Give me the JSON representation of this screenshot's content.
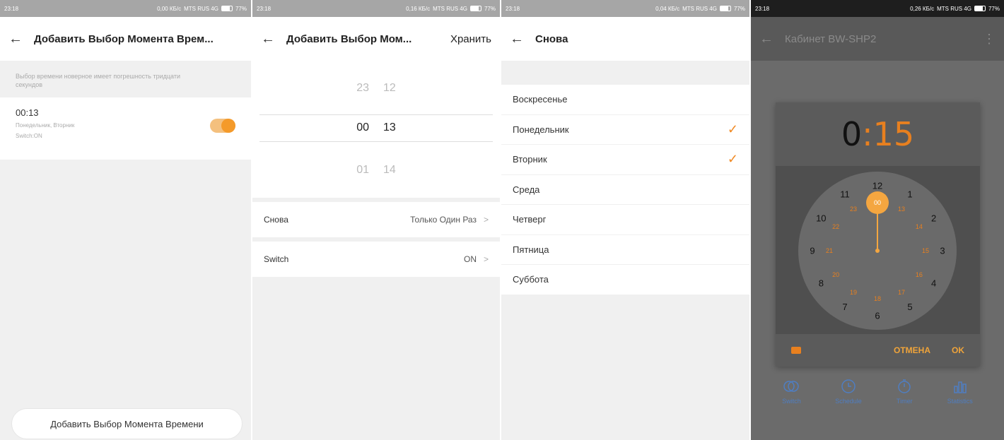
{
  "screens": [
    {
      "status": {
        "time": "23:18",
        "net": "0,00 КБ/с",
        "carrier": "MTS RUS 4G",
        "battery": "77%"
      },
      "appbar": {
        "back": "←",
        "title": "Добавить Выбор Момента Врем..."
      },
      "hint": "Выбор времени новерное имеет погрешность тридцати секундов",
      "item": {
        "time": "00:13",
        "days": "Понедельник, Вторник",
        "switch": "Switch:ON"
      },
      "add_button": "Добавить Выбор Момента Времени"
    },
    {
      "status": {
        "time": "23:18",
        "net": "0,16 КБ/с",
        "carrier": "MTS RUS 4G",
        "battery": "77%"
      },
      "appbar": {
        "back": "←",
        "title": "Добавить Выбор Мом...",
        "save": "Хранить"
      },
      "picker": {
        "prev_hour": "23",
        "prev_min": "12",
        "hour": "00",
        "min": "13",
        "next_hour": "01",
        "next_min": "14"
      },
      "repeat": {
        "label": "Снова",
        "value": "Только Один Раз",
        "chevron": ">"
      },
      "switch": {
        "label": "Switch",
        "value": "ON",
        "chevron": ">"
      }
    },
    {
      "status": {
        "time": "23:18",
        "net": "0,04 КБ/с",
        "carrier": "MTS RUS 4G",
        "battery": "77%"
      },
      "appbar": {
        "back": "←",
        "title": "Снова"
      },
      "days": [
        {
          "label": "Воскресенье",
          "checked": false
        },
        {
          "label": "Понедельник",
          "checked": true
        },
        {
          "label": "Вторник",
          "checked": true
        },
        {
          "label": "Среда",
          "checked": false
        },
        {
          "label": "Четверг",
          "checked": false
        },
        {
          "label": "Пятница",
          "checked": false
        },
        {
          "label": "Суббота",
          "checked": false
        }
      ],
      "check_glyph": "✓"
    },
    {
      "status": {
        "time": "23:18",
        "net": "0,26 КБ/с",
        "carrier": "MTS RUS 4G",
        "battery": "77%"
      },
      "appbar": {
        "back": "←",
        "title": "Кабинет BW-SHP2",
        "menu": "⋮"
      },
      "dialog": {
        "hour": "0",
        "sep": ":",
        "minute": "15",
        "outer": [
          "12",
          "1",
          "2",
          "3",
          "4",
          "5",
          "6",
          "7",
          "8",
          "9",
          "10",
          "11"
        ],
        "inner": [
          "00",
          "13",
          "14",
          "15",
          "16",
          "17",
          "18",
          "19",
          "20",
          "21",
          "22",
          "23"
        ],
        "selected": "00",
        "cancel": "ОТМЕНА",
        "ok": "OK"
      },
      "nav": [
        {
          "label": "Switch",
          "icon": "switch-icon"
        },
        {
          "label": "Schedule",
          "icon": "clock-icon"
        },
        {
          "label": "Timer",
          "icon": "timer-icon"
        },
        {
          "label": "Statistics",
          "icon": "bar-chart-icon"
        }
      ],
      "colors": {
        "accent": "#e8801f",
        "nav": "#4f7ec2"
      }
    }
  ]
}
